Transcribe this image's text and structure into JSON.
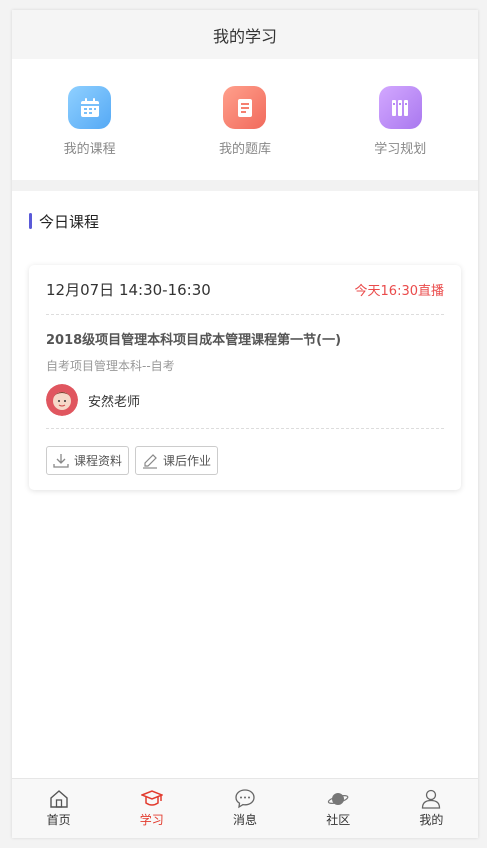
{
  "header": {
    "title": "我的学习"
  },
  "quick_links": [
    {
      "label": "我的课程",
      "icon": "calendar-icon",
      "color_from": "#8fd0ff",
      "color_to": "#55a9f5"
    },
    {
      "label": "我的题库",
      "icon": "question-bank-icon",
      "color_from": "#ffa08c",
      "color_to": "#f16a5c"
    },
    {
      "label": "学习规划",
      "icon": "books-icon",
      "color_from": "#d3a8ff",
      "color_to": "#a978ef"
    }
  ],
  "section": {
    "title": "今日课程",
    "accent": "#5a5ad8"
  },
  "course": {
    "time": "12月07日 14:30-16:30",
    "live": "今天16:30直播",
    "title": "2018级项目管理本科项目成本管理课程第一节(一)",
    "subtitle": "自考项目管理本科--自考",
    "teacher": "安然老师",
    "buttons": {
      "materials": "课程资料",
      "homework": "课后作业"
    }
  },
  "tabbar": {
    "items": [
      {
        "label": "首页",
        "icon": "home-icon"
      },
      {
        "label": "学习",
        "icon": "graduation-cap-icon",
        "active": true
      },
      {
        "label": "消息",
        "icon": "chat-bubble-icon"
      },
      {
        "label": "社区",
        "icon": "planet-icon"
      },
      {
        "label": "我的",
        "icon": "user-icon"
      }
    ],
    "active_color": "#e23b2e"
  }
}
